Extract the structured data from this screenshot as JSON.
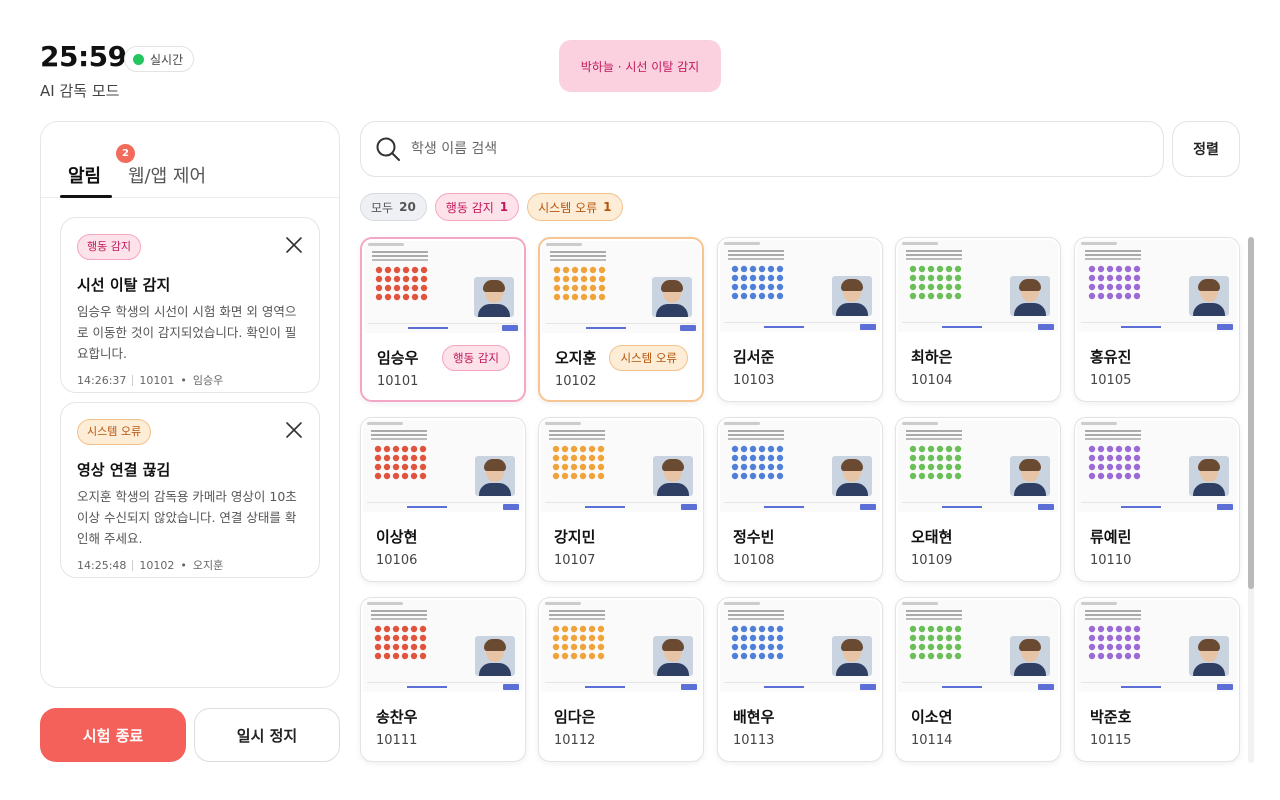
{
  "header": {
    "timer": "25:59",
    "live_label": "실시간",
    "mode_label": "AI 감독 모드"
  },
  "toast": {
    "text": "박하늘 · 시선 이탈 감지"
  },
  "panel": {
    "tabs": [
      {
        "label": "알림",
        "active": true,
        "count": "2"
      },
      {
        "label": "웹/앱 제어",
        "active": false
      }
    ],
    "alerts": [
      {
        "tag": "행동 감지",
        "title": "시선 이탈 감지",
        "body": "임승우 학생의 시선이 시험 화면 외 영역으로 이동한 것이 감지되었습니다. 확인이 필요합니다.",
        "time": "14:26:37",
        "student_id": "10101",
        "student_name": "임승우",
        "close_icon": "close-icon"
      },
      {
        "tag": "시스템 오류",
        "title": "영상 연결 끊김",
        "body": "오지훈 학생의 감독용 카메라 영상이 10초 이상 수신되지 않았습니다. 연결 상태를 확인해 주세요.",
        "time": "14:25:48",
        "student_id": "10102",
        "student_name": "오지훈",
        "close_icon": "close-icon"
      }
    ]
  },
  "actions": {
    "end_label": "시험 종료",
    "pause_label": "일시 정지"
  },
  "search": {
    "placeholder": "학생 이름 검색",
    "value": "",
    "icon": "search-icon"
  },
  "sort": {
    "label": "정렬"
  },
  "filters": [
    {
      "label": "모두",
      "count": "20"
    },
    {
      "label": "행동 감지",
      "count": "1"
    },
    {
      "label": "시스템 오류",
      "count": "1"
    }
  ],
  "students": [
    {
      "name": "임승우",
      "id": "10101",
      "tag": "행동 감지",
      "flag": "behavior"
    },
    {
      "name": "오지훈",
      "id": "10102",
      "tag": "시스템 오류",
      "flag": "system"
    },
    {
      "name": "김서준",
      "id": "10103",
      "tag": "",
      "flag": ""
    },
    {
      "name": "최하은",
      "id": "10104",
      "tag": "",
      "flag": ""
    },
    {
      "name": "홍유진",
      "id": "10105",
      "tag": "",
      "flag": ""
    },
    {
      "name": "이상현",
      "id": "10106",
      "tag": "",
      "flag": ""
    },
    {
      "name": "강지민",
      "id": "10107",
      "tag": "",
      "flag": ""
    },
    {
      "name": "정수빈",
      "id": "10108",
      "tag": "",
      "flag": ""
    },
    {
      "name": "오태현",
      "id": "10109",
      "tag": "",
      "flag": ""
    },
    {
      "name": "류예린",
      "id": "10110",
      "tag": "",
      "flag": ""
    },
    {
      "name": "송찬우",
      "id": "10111",
      "tag": "",
      "flag": ""
    },
    {
      "name": "임다은",
      "id": "10112",
      "tag": "",
      "flag": ""
    },
    {
      "name": "배현우",
      "id": "10113",
      "tag": "",
      "flag": ""
    },
    {
      "name": "이소연",
      "id": "10114",
      "tag": "",
      "flag": ""
    },
    {
      "name": "박준호",
      "id": "10115",
      "tag": "",
      "flag": ""
    }
  ],
  "colors": {
    "live": "#22c55e",
    "end_button": "#f4615a",
    "behavior": "#c2185b",
    "system": "#b5540b",
    "accent": "#5b6fd6"
  }
}
